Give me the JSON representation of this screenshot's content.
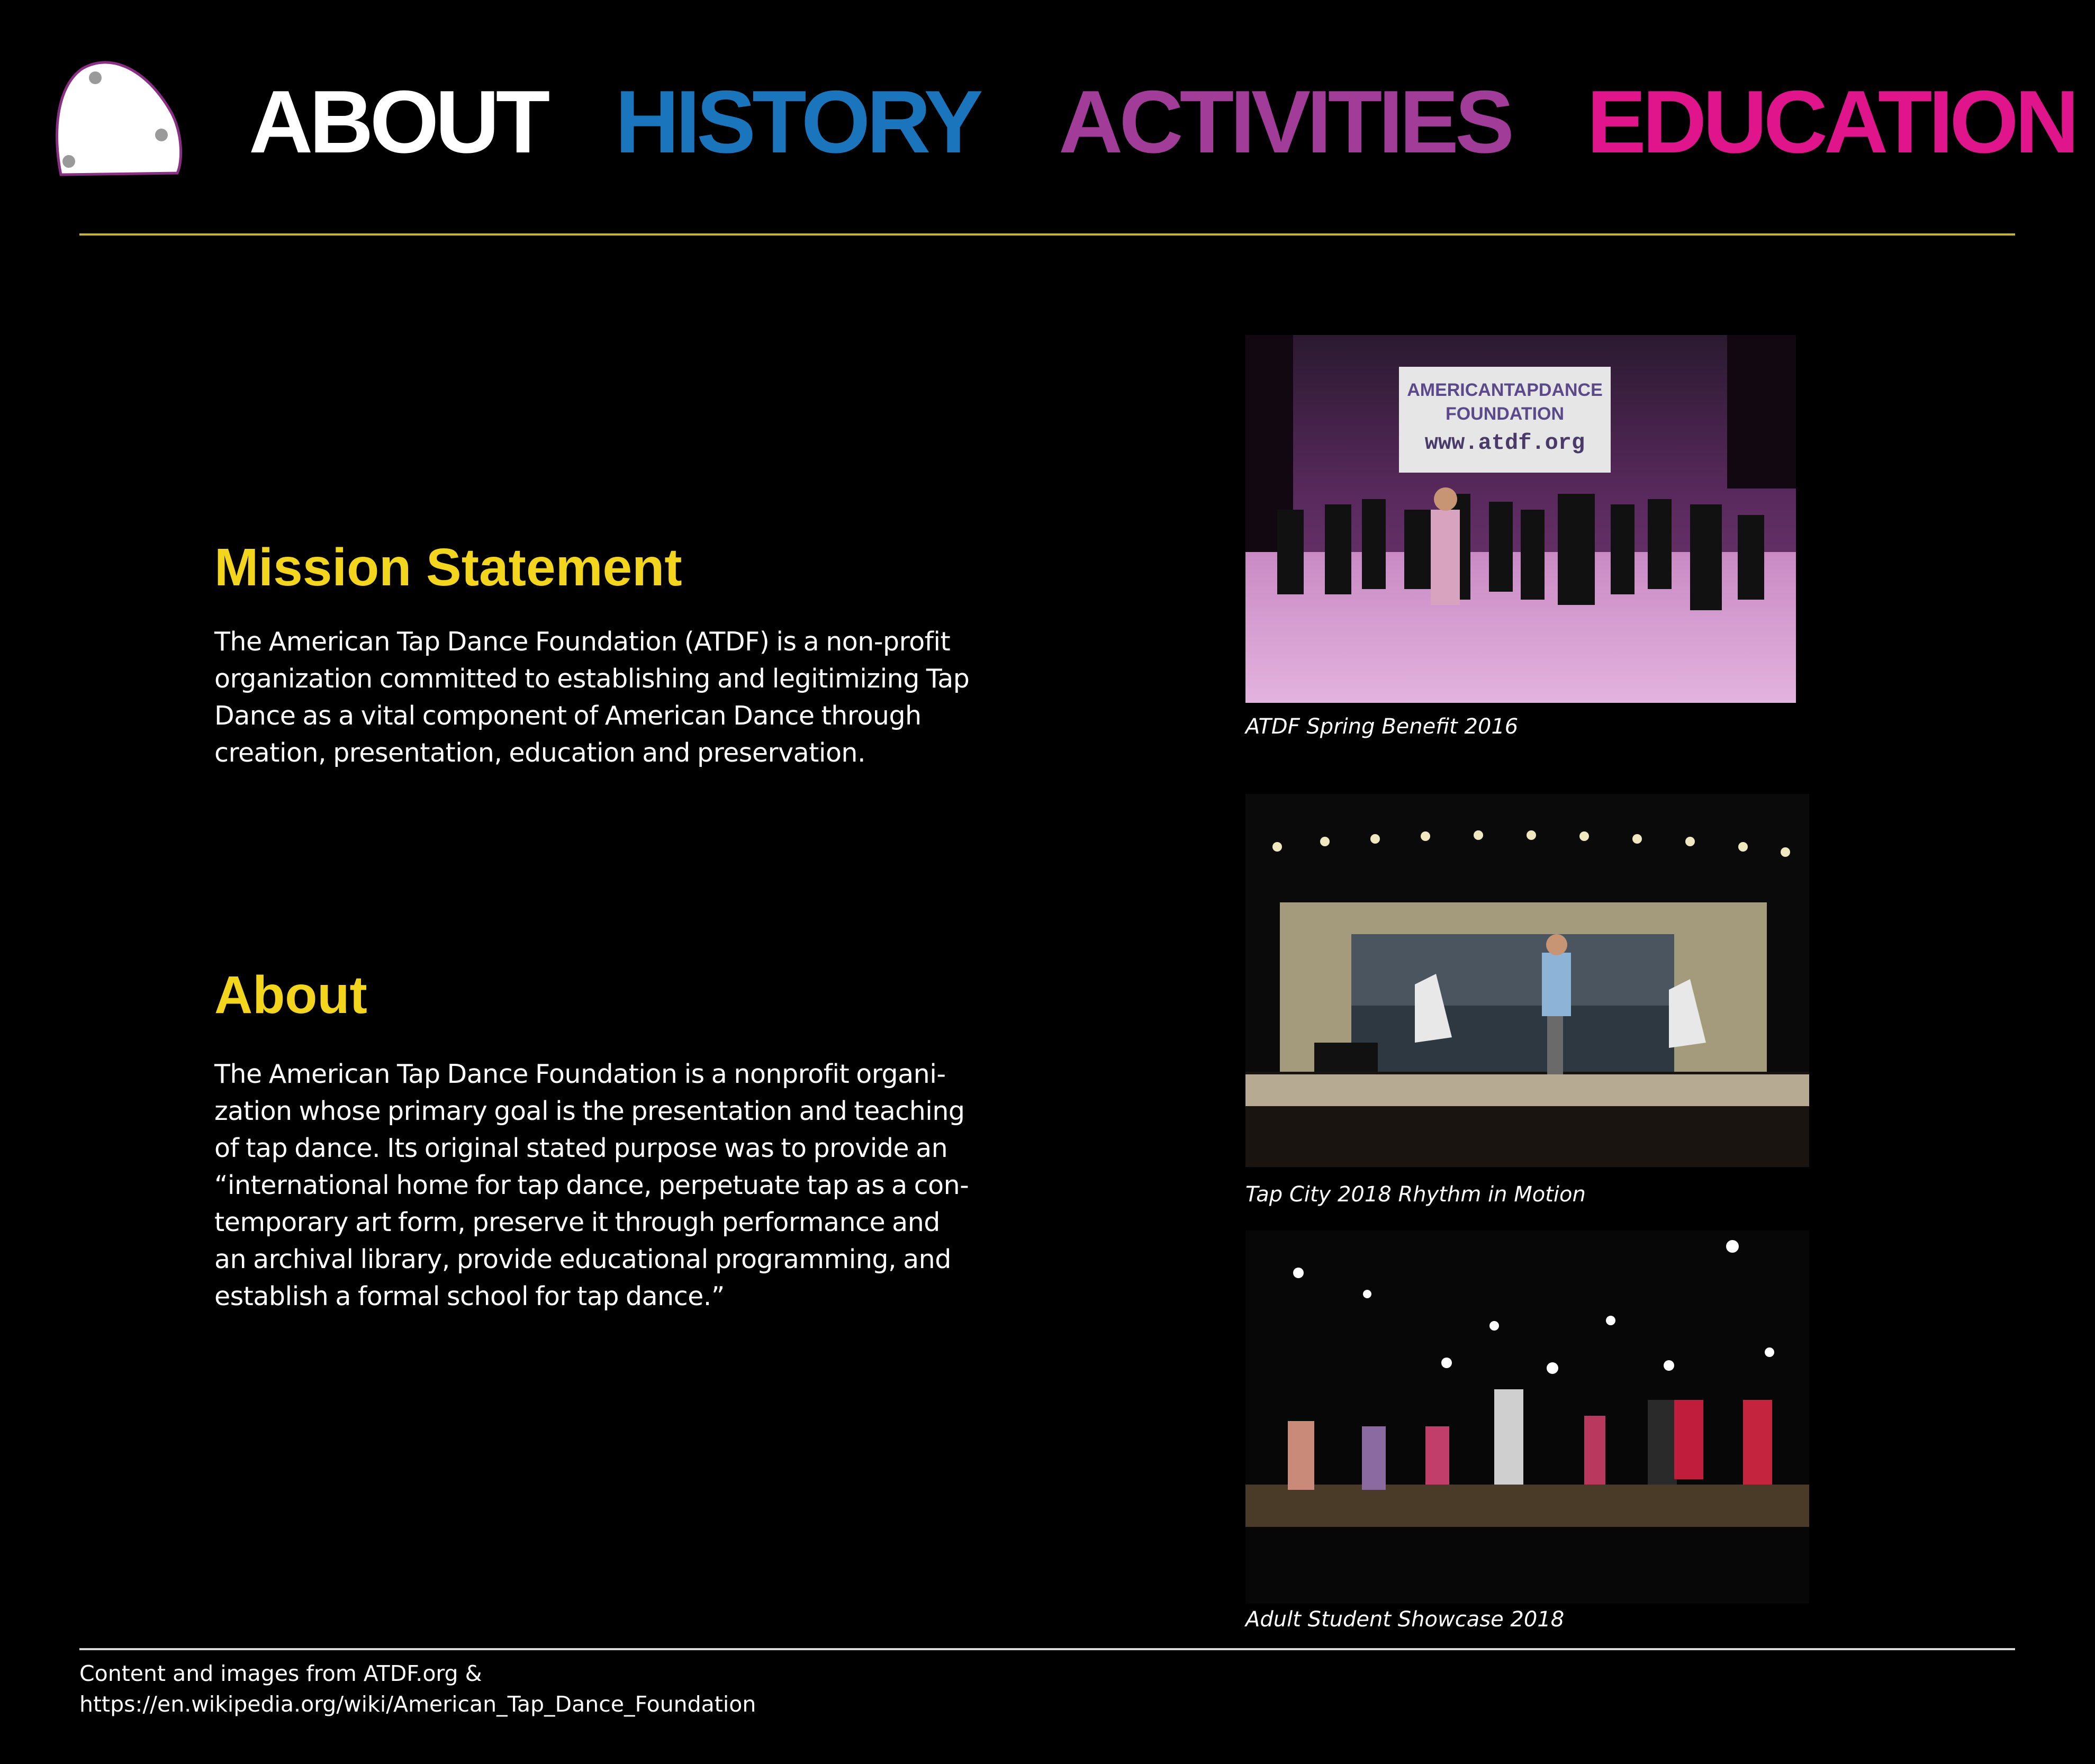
{
  "nav": {
    "items": [
      {
        "label": "ABOUT",
        "color": "#ffffff",
        "active": true
      },
      {
        "label": "HISTORY",
        "color": "#1b75bc"
      },
      {
        "label": "ACTIVITIES",
        "color": "#a13d98"
      },
      {
        "label": "EDUCATION",
        "color": "#e0158b"
      }
    ]
  },
  "logo": {
    "icon": "tap-shoe-plate-icon"
  },
  "mission": {
    "title": "Mission Statement",
    "text": "The American Tap Dance Foundation (ATDF) is a non-profit organization committed to establishing and legitimizing Tap Dance as a vital component of American Dance through creation, presentation, education and  preservation."
  },
  "about": {
    "title": "About",
    "text": "The American Tap Dance Foundation is a nonprofit organi-zation whose primary goal is the presentation and teaching of tap dance. Its original stated purpose was to provide an “international home for tap dance, perpetuate tap as a con-temporary art form, preserve it through performance and an archival library, provide educational programming, and establish a formal school for tap dance.”"
  },
  "photos": [
    {
      "caption": "ATDF Spring Benefit 2016",
      "banner_line1": "AMERICANTAPDANCE",
      "banner_line2": "FOUNDATION",
      "banner_line3": "www.atdf.org"
    },
    {
      "caption": "Tap City 2018 Rhythm in Motion"
    },
    {
      "caption": "Adult Student Showcase 2018"
    }
  ],
  "credits": {
    "line1": "Content and images from ATDF.org &",
    "line2": "https://en.wikipedia.org/wiki/American_Tap_Dance_Foundation"
  },
  "colors": {
    "background": "#000000",
    "section_heading": "#f2d51c",
    "top_rule": "#c8b62a"
  }
}
